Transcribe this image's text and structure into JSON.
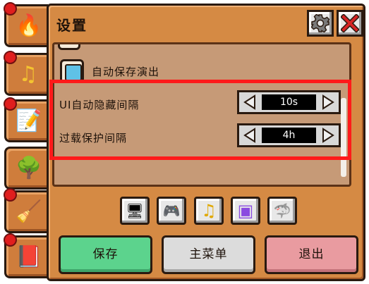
{
  "panel": {
    "title": "设置"
  },
  "header": {
    "settings_icon": "gear-icon",
    "close_icon": "close-icon"
  },
  "tabs": [
    {
      "icon": "fire-icon",
      "glyph": "🔥"
    },
    {
      "icon": "music-note-icon",
      "glyph": "♫"
    },
    {
      "icon": "notepad-icon",
      "glyph": "📝"
    },
    {
      "icon": "bonsai-icon",
      "glyph": "🌳"
    },
    {
      "icon": "cleaning-brush-icon",
      "glyph": "🧹"
    },
    {
      "icon": "book-icon",
      "glyph": "📕"
    }
  ],
  "list": {
    "auto_save_label": "自动保存演出",
    "auto_save_checked": true,
    "ui_hide_label": "UI自动隐藏间隔",
    "ui_hide_value": "10s",
    "overload_label": "过载保护间隔",
    "overload_value": "4h"
  },
  "categories": [
    {
      "icon": "monitor-icon",
      "glyph": "🖥"
    },
    {
      "icon": "gamepad-icon",
      "glyph": "🎮"
    },
    {
      "icon": "music-note-icon",
      "glyph": "♫"
    },
    {
      "icon": "twitch-icon",
      "glyph": "▣"
    },
    {
      "icon": "shark-icon",
      "glyph": "🦈"
    }
  ],
  "buttons": {
    "save": "保存",
    "main_menu": "主菜单",
    "quit": "退出"
  },
  "colors": {
    "panel": "#d58a44",
    "list_bg": "#c69a77",
    "highlight": "#ff1a1a",
    "save_btn": "#5cd38d",
    "menu_btn": "#dcdcdc",
    "quit_btn": "#e99ba0",
    "checkbox_fill": "#5fc1e6"
  }
}
